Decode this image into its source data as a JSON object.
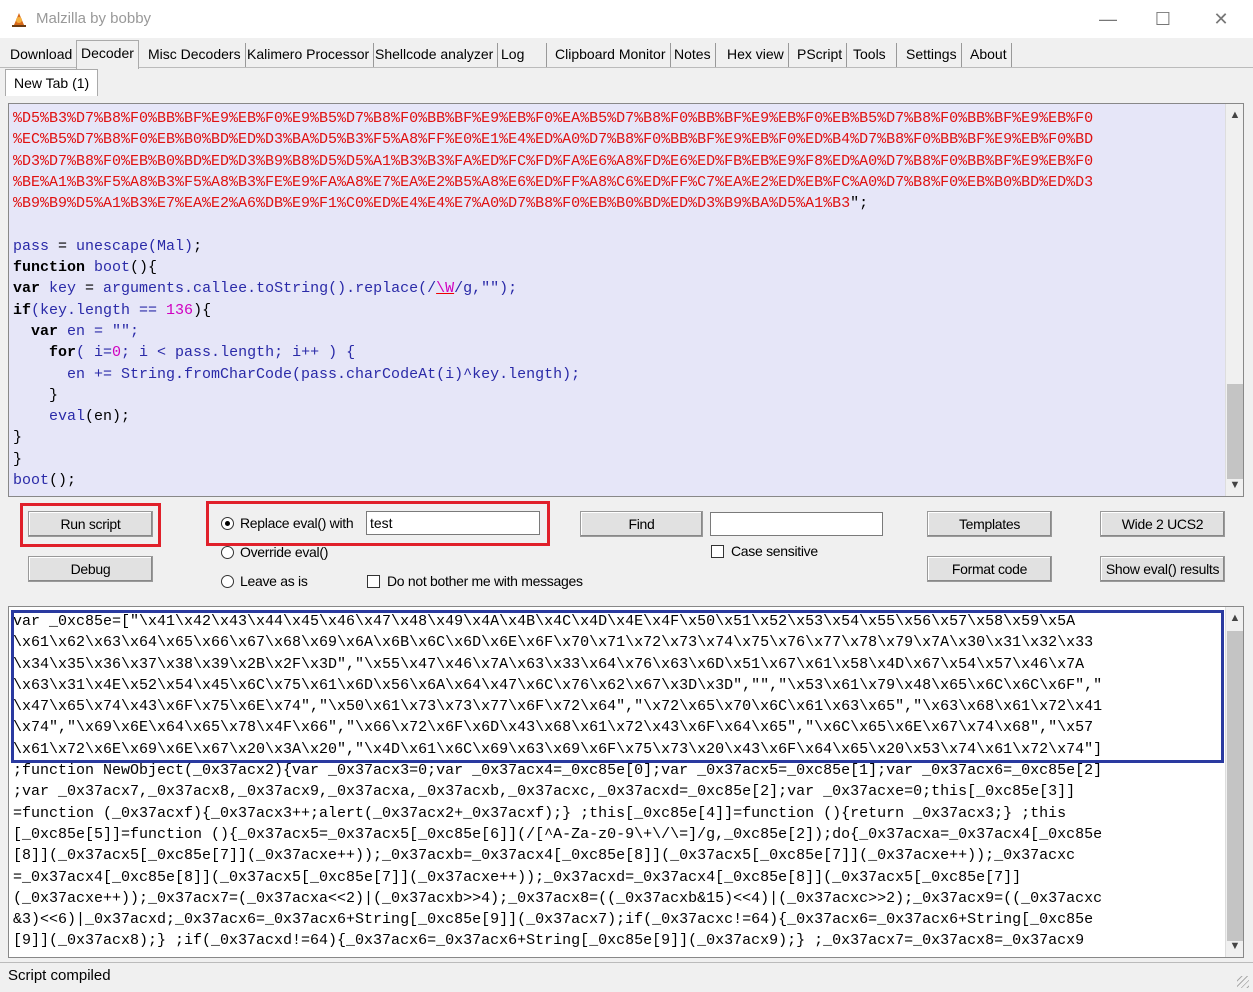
{
  "window": {
    "title": "Malzilla by bobby",
    "minimize": "—",
    "maximize": "☐",
    "close": "✕"
  },
  "tabs": [
    "Download",
    "Decoder",
    "Misc Decoders",
    "Kalimero Processor",
    "Shellcode analyzer",
    "Log",
    "Clipboard Monitor",
    "Notes",
    "Hex view",
    "PScript",
    "Tools",
    "Settings",
    "About"
  ],
  "active_tab": "Decoder",
  "subtab": "New Tab (1)",
  "editor": {
    "hex_lines": [
      "%D5%B3%D7%B8%F0%BB%BF%E9%EB%F0%E9%B5%D7%B8%F0%BB%BF%E9%EB%F0%EA%B5%D7%B8%F0%BB%BF%E9%EB%F0%EB%B5%D7%B8%F0%BB%BF%E9%EB%F0",
      "%EC%B5%D7%B8%F0%EB%B0%BD%ED%D3%BA%D5%B3%F5%A8%FF%E0%E1%E4%ED%A0%D7%B8%F0%BB%BF%E9%EB%F0%ED%B4%D7%B8%F0%BB%BF%E9%EB%F0%BD",
      "%D3%D7%B8%F0%EB%B0%BD%ED%D3%B9%B8%D5%D5%A1%B3%B3%FA%ED%FC%FD%FA%E6%A8%FD%E6%ED%FB%EB%E9%F8%ED%A0%D7%B8%F0%BB%BF%E9%EB%F0",
      "%BE%A1%B3%F5%A8%B3%F5%A8%B3%FE%E9%FA%A8%E7%EA%E2%B5%A8%E6%ED%FF%A8%C6%ED%FF%C7%EA%E2%ED%EB%FC%A0%D7%B8%F0%EB%B0%BD%ED%D3",
      "%B9%B9%D5%A1%B3%E7%EA%E2%A6%DB%E9%F1%C0%ED%E4%E4%E7%A0%D7%B8%F0%EB%B0%BD%ED%D3%B9%BA%D5%A1%B3"
    ],
    "hex_tail": "\";",
    "code": {
      "l1_var": "pass",
      "l1_eq": " = ",
      "l1_fn": "unescape",
      "l1_arg": "(Mal)",
      "l1_end": ";",
      "l2_kw": "function",
      "l2_name": " boot",
      "l2_rest": "(){",
      "l3_kw": "var",
      "l3_a": " key",
      "l3_b": " = ",
      "l3_c": "arguments.callee.toString().replace(/",
      "l3_d": "\\W",
      "l3_e": "/g,\"\");",
      "l4_kw": "if",
      "l4_a": "(key.length == ",
      "l4_num": "136",
      "l4_b": "){",
      "l5_kw": "  var",
      "l5_a": " en = \"\";",
      "l6_kw": "    for",
      "l6_a": "( i=",
      "l6_num": "0",
      "l6_b": "; i < pass.length; i++ ) {",
      "l7_a": "      en += String.fromCharCode(pass.charCodeAt(i)^key.length);",
      "l8": "    }",
      "l9_kw": "    eval",
      "l9_a": "(en);",
      "l10": "}",
      "l11": "}",
      "l12_a": "boot",
      "l12_b": "();"
    }
  },
  "controls": {
    "run_script": "Run script",
    "debug": "Debug",
    "replace_eval_label": "Replace eval() with",
    "replace_eval_value": "test",
    "override_eval": "Override eval()",
    "leave_as_is": "Leave as is",
    "no_bother": "Do not bother me with messages",
    "find": "Find",
    "find_value": "",
    "case_sensitive": "Case sensitive",
    "templates": "Templates",
    "format_code": "Format code",
    "wide_ucs2": "Wide 2 UCS2",
    "show_eval": "Show eval() results"
  },
  "output_lines": [
    "var _0xc85e=[\"\\x41\\x42\\x43\\x44\\x45\\x46\\x47\\x48\\x49\\x4A\\x4B\\x4C\\x4D\\x4E\\x4F\\x50\\x51\\x52\\x53\\x54\\x55\\x56\\x57\\x58\\x59\\x5A",
    "\\x61\\x62\\x63\\x64\\x65\\x66\\x67\\x68\\x69\\x6A\\x6B\\x6C\\x6D\\x6E\\x6F\\x70\\x71\\x72\\x73\\x74\\x75\\x76\\x77\\x78\\x79\\x7A\\x30\\x31\\x32\\x33",
    "\\x34\\x35\\x36\\x37\\x38\\x39\\x2B\\x2F\\x3D\",\"\\x55\\x47\\x46\\x7A\\x63\\x33\\x64\\x76\\x63\\x6D\\x51\\x67\\x61\\x58\\x4D\\x67\\x54\\x57\\x46\\x7A",
    "\\x63\\x31\\x4E\\x52\\x54\\x45\\x6C\\x75\\x61\\x6D\\x56\\x6A\\x64\\x47\\x6C\\x76\\x62\\x67\\x3D\\x3D\",\"\",\"\\x53\\x61\\x79\\x48\\x65\\x6C\\x6C\\x6F\",\"",
    "\\x47\\x65\\x74\\x43\\x6F\\x75\\x6E\\x74\",\"\\x50\\x61\\x73\\x73\\x77\\x6F\\x72\\x64\",\"\\x72\\x65\\x70\\x6C\\x61\\x63\\x65\",\"\\x63\\x68\\x61\\x72\\x41",
    "\\x74\",\"\\x69\\x6E\\x64\\x65\\x78\\x4F\\x66\",\"\\x66\\x72\\x6F\\x6D\\x43\\x68\\x61\\x72\\x43\\x6F\\x64\\x65\",\"\\x6C\\x65\\x6E\\x67\\x74\\x68\",\"\\x57",
    "\\x61\\x72\\x6E\\x69\\x6E\\x67\\x20\\x3A\\x20\",\"\\x4D\\x61\\x6C\\x69\\x63\\x69\\x6F\\x75\\x73\\x20\\x43\\x6F\\x64\\x65\\x20\\x53\\x74\\x61\\x72\\x74\"]",
    ";function NewObject(_0x37acx2){var _0x37acx3=0;var _0x37acx4=_0xc85e[0];var _0x37acx5=_0xc85e[1];var _0x37acx6=_0xc85e[2]",
    ";var _0x37acx7,_0x37acx8,_0x37acx9,_0x37acxa,_0x37acxb,_0x37acxc,_0x37acxd=_0xc85e[2];var _0x37acxe=0;this[_0xc85e[3]]",
    "=function (_0x37acxf){_0x37acx3++;alert(_0x37acx2+_0x37acxf);} ;this[_0xc85e[4]]=function (){return _0x37acx3;} ;this",
    "[_0xc85e[5]]=function (){_0x37acx5=_0x37acx5[_0xc85e[6]](/[^A-Za-z0-9\\+\\/\\=]/g,_0xc85e[2]);do{_0x37acxa=_0x37acx4[_0xc85e",
    "[8]](_0x37acx5[_0xc85e[7]](_0x37acxe++));_0x37acxb=_0x37acx4[_0xc85e[8]](_0x37acx5[_0xc85e[7]](_0x37acxe++));_0x37acxc",
    "=_0x37acx4[_0xc85e[8]](_0x37acx5[_0xc85e[7]](_0x37acxe++));_0x37acxd=_0x37acx4[_0xc85e[8]](_0x37acx5[_0xc85e[7]]",
    "(_0x37acxe++));_0x37acx7=(_0x37acxa<<2)|(_0x37acxb>>4);_0x37acx8=((_0x37acxb&15)<<4)|(_0x37acxc>>2);_0x37acx9=((_0x37acxc",
    "&3)<<6)|_0x37acxd;_0x37acx6=_0x37acx6+String[_0xc85e[9]](_0x37acx7);if(_0x37acxc!=64){_0x37acx6=_0x37acx6+String[_0xc85e",
    "[9]](_0x37acx8);} ;if(_0x37acxd!=64){_0x37acx6=_0x37acx6+String[_0xc85e[9]](_0x37acx9);} ;_0x37acx7=_0x37acx8=_0x37acx9"
  ],
  "status": "Script compiled"
}
